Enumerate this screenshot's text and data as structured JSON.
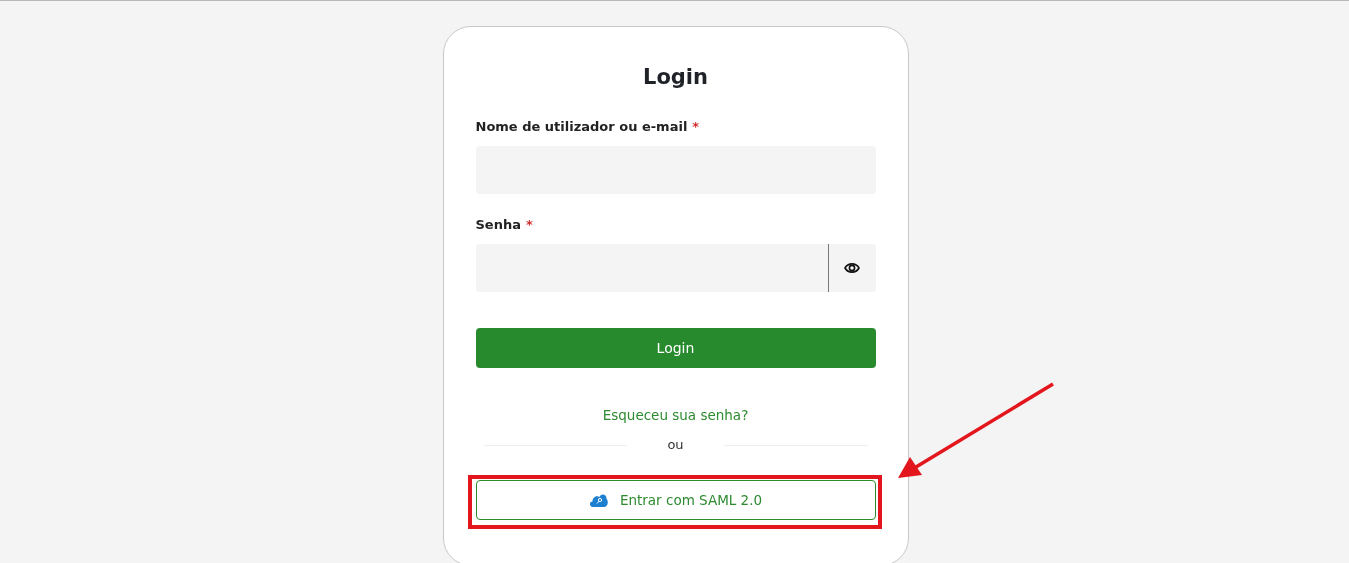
{
  "title": "Login",
  "fields": [
    {
      "label": "Nome de utilizador ou e-mail",
      "required_mark": "*",
      "kind": "text"
    },
    {
      "label": "Senha",
      "required_mark": "*",
      "kind": "password"
    }
  ],
  "login_button": "Login",
  "forgot_link": "Esqueceu sua senha?",
  "divider_text": "ou",
  "saml_button": "Entrar com SAML 2.0",
  "annotation": {
    "highlight": true,
    "arrow": true
  }
}
